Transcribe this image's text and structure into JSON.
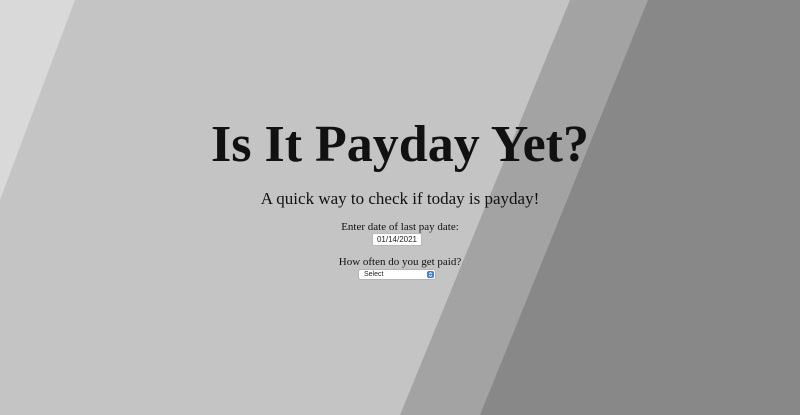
{
  "page": {
    "title": "Is It Payday Yet?",
    "subtitle": "A quick way to check if today is payday!"
  },
  "form": {
    "last_pay_date_label": "Enter date of last pay date:",
    "last_pay_date_value": "01/14/2021",
    "frequency_label": "How often do you get paid?",
    "frequency_selected": "Select"
  },
  "colors": {
    "background_light": "#d9d9d9",
    "background_mid": "#c4c4c4",
    "stripe": "#a3a3a3",
    "background_dark": "#888888",
    "text": "#111111",
    "select_accent": "#3b7fe0"
  },
  "icons": {
    "select_arrow": "chevron-updown-icon"
  }
}
